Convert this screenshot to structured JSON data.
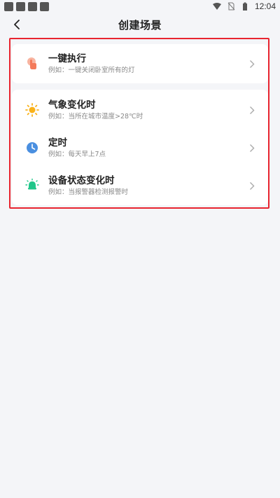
{
  "status_bar": {
    "time": "12:04",
    "notification_icons": [
      "app-notification-icon",
      "app-notification-icon",
      "app-notification-icon",
      "app-notification-icon"
    ],
    "right_icons": [
      "wifi-icon",
      "no-sim-icon",
      "battery-icon"
    ]
  },
  "header": {
    "title": "创建场景",
    "back_icon": "back-arrow-icon"
  },
  "accent_colors": {
    "highlight_border": "#e8242f",
    "one_tap": "#f47a5a",
    "weather": "#f9b21b",
    "timer": "#4a8fe0",
    "device": "#20c68a"
  },
  "scenes": {
    "one_tap": {
      "title": "一键执行",
      "example": "例如：一键关闭卧室所有的灯",
      "icon": "hand-tap-icon"
    },
    "weather": {
      "title": "气象变化时",
      "example": "例如：当所在城市温度>28℃时",
      "icon": "sun-icon"
    },
    "timer": {
      "title": "定时",
      "example": "例如：每天早上7点",
      "icon": "clock-icon"
    },
    "device": {
      "title": "设备状态变化时",
      "example": "例如：当报警器检测报警时",
      "icon": "bulb-icon"
    }
  }
}
